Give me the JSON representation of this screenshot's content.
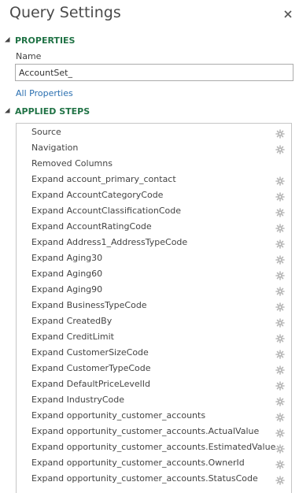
{
  "pane": {
    "title": "Query Settings"
  },
  "properties": {
    "header": "PROPERTIES",
    "name_label": "Name",
    "name_value": "AccountSet_",
    "all_properties_link": "All Properties"
  },
  "applied_steps": {
    "header": "APPLIED STEPS",
    "steps": [
      {
        "label": "Source",
        "has_settings": true
      },
      {
        "label": "Navigation",
        "has_settings": true
      },
      {
        "label": "Removed Columns",
        "has_settings": false
      },
      {
        "label": "Expand account_primary_contact",
        "has_settings": true
      },
      {
        "label": "Expand AccountCategoryCode",
        "has_settings": true
      },
      {
        "label": "Expand AccountClassificationCode",
        "has_settings": true
      },
      {
        "label": "Expand AccountRatingCode",
        "has_settings": true
      },
      {
        "label": "Expand Address1_AddressTypeCode",
        "has_settings": true
      },
      {
        "label": "Expand Aging30",
        "has_settings": true
      },
      {
        "label": "Expand Aging60",
        "has_settings": true
      },
      {
        "label": "Expand Aging90",
        "has_settings": true
      },
      {
        "label": "Expand BusinessTypeCode",
        "has_settings": true
      },
      {
        "label": "Expand CreatedBy",
        "has_settings": true
      },
      {
        "label": "Expand CreditLimit",
        "has_settings": true
      },
      {
        "label": "Expand CustomerSizeCode",
        "has_settings": true
      },
      {
        "label": "Expand CustomerTypeCode",
        "has_settings": true
      },
      {
        "label": "Expand DefaultPriceLevelId",
        "has_settings": true
      },
      {
        "label": "Expand IndustryCode",
        "has_settings": true
      },
      {
        "label": "Expand opportunity_customer_accounts",
        "has_settings": true
      },
      {
        "label": "Expand opportunity_customer_accounts.ActualValue",
        "has_settings": true
      },
      {
        "label": "Expand opportunity_customer_accounts.EstimatedValue",
        "has_settings": true
      },
      {
        "label": "Expand opportunity_customer_accounts.OwnerId",
        "has_settings": true
      },
      {
        "label": "Expand opportunity_customer_accounts.StatusCode",
        "has_settings": true
      }
    ]
  },
  "icons": {
    "close": "close-icon",
    "collapse": "collapse-triangle-icon",
    "settings": "gear-icon"
  },
  "colors": {
    "section_header": "#217346",
    "link": "#2a6fb0",
    "gear": "#b8b8b8",
    "border": "#c6c6c6"
  }
}
